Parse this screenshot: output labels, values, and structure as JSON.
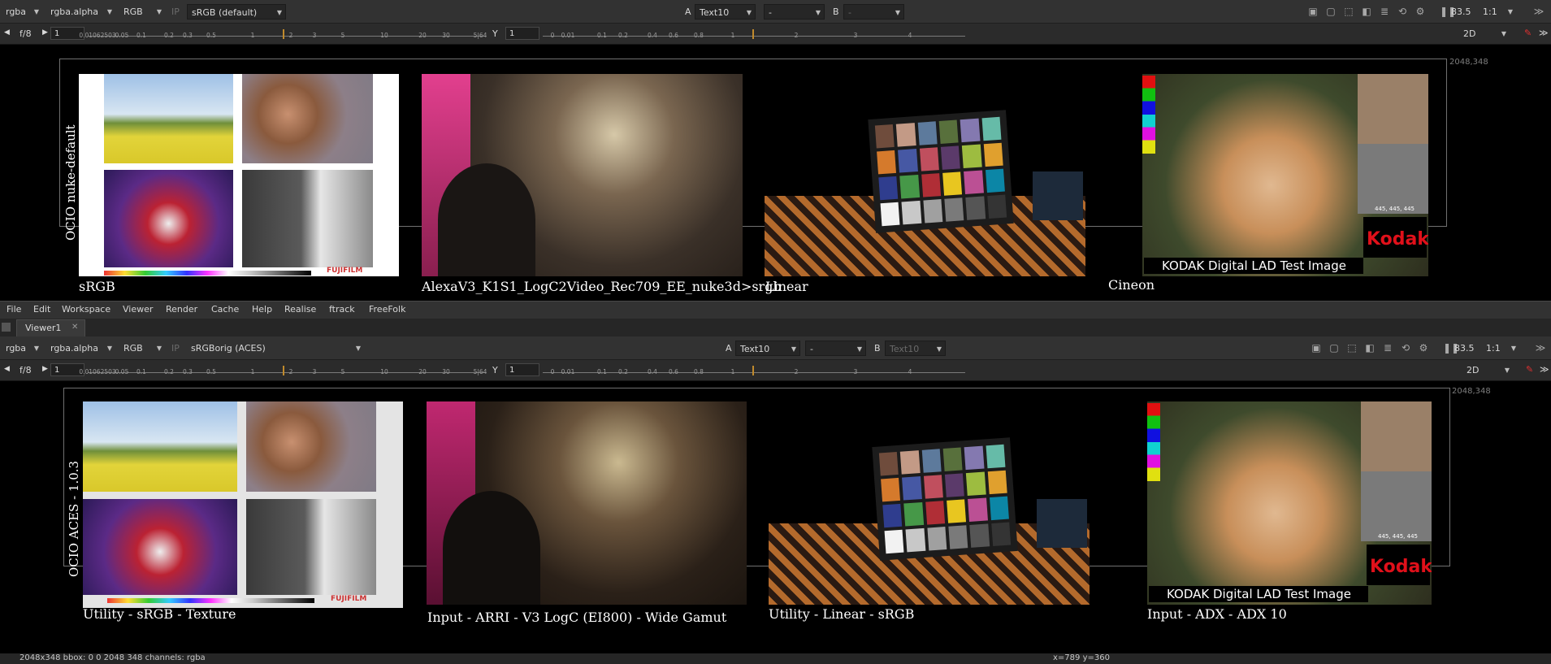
{
  "viewers": [
    {
      "toolbar": {
        "channels": "rgba",
        "alpha": "rgba.alpha",
        "display": "RGB",
        "ip_label": "IP",
        "colorspace": "sRGB (default)",
        "a_label": "A",
        "a_input": "Text10",
        "compare": "-",
        "b_label": "B",
        "b_input": "-",
        "zoom_pct": "83.5",
        "ratio": "1:1"
      },
      "controls": {
        "fstop": "f/8",
        "gain": "1",
        "y_label": "Y",
        "gamma": "1",
        "mode": "2D",
        "gain_ticks": [
          "0.01062503",
          "0.05",
          "0.1",
          "0.2",
          "0.3",
          "0.5",
          "1",
          "2",
          "3",
          "5",
          "10",
          "20",
          "30",
          "5|64"
        ],
        "gamma_ticks": [
          "0",
          "0.01",
          "0.1",
          "0.2",
          "0.4",
          "0.6",
          "0.8",
          "1",
          "2",
          "3",
          "4"
        ]
      },
      "format_coord": "2048,348",
      "side_label": "OCIO nuke-default",
      "captions": [
        "sRGB",
        "AlexaV3_K1S1_LogC2Video_Rec709_EE_nuke3d>srgb",
        "Linear",
        "Cineon"
      ],
      "kodak_caption": "KODAK Digital LAD Test Image",
      "kodak_logo": "Kodak",
      "fujifilm": "FUJIFILM",
      "patch_values": "445, 445, 445"
    },
    {
      "toolbar": {
        "channels": "rgba",
        "alpha": "rgba.alpha",
        "display": "RGB",
        "ip_label": "IP",
        "colorspace": "sRGBorig (ACES)",
        "a_label": "A",
        "a_input": "Text10",
        "compare": "-",
        "b_label": "B",
        "b_input": "Text10",
        "zoom_pct": "83.5",
        "ratio": "1:1"
      },
      "controls": {
        "fstop": "f/8",
        "gain": "1",
        "y_label": "Y",
        "gamma": "1",
        "mode": "2D",
        "gain_ticks": [
          "0.01062503",
          "0.05",
          "0.1",
          "0.2",
          "0.3",
          "0.5",
          "1",
          "2",
          "3",
          "5",
          "10",
          "20",
          "30",
          "5|64"
        ],
        "gamma_ticks": [
          "0",
          "0.01",
          "0.1",
          "0.2",
          "0.4",
          "0.6",
          "0.8",
          "1",
          "2",
          "3",
          "4"
        ]
      },
      "format_coord": "2048,348",
      "side_label": "OCIO ACES - 1.0.3",
      "captions": [
        "Utility - sRGB - Texture",
        "Input - ARRI - V3 LogC (EI800) - Wide Gamut",
        "Utility - Linear - sRGB",
        "Input - ADX - ADX 10"
      ],
      "kodak_caption": "KODAK Digital LAD Test Image",
      "kodak_logo": "Kodak",
      "fujifilm": "FUJIFILM",
      "patch_values": "445, 445, 445"
    }
  ],
  "menu": [
    "File",
    "Edit",
    "Workspace",
    "Viewer",
    "Render",
    "Cache",
    "Help",
    "Realise",
    "ftrack",
    "FreeFolk"
  ],
  "viewer_tab": "Viewer1",
  "status": {
    "info": "2048x348  bbox: 0 0 2048 348  channels: rgba",
    "cursor": "x=789 y=360"
  },
  "colors": {
    "chrome": "#323232",
    "viewport": "#000000",
    "accent_handle": "#c08a2c",
    "kodak_red": "#e0101a"
  },
  "icons": [
    "rgb-swatch-icon",
    "frame-icon",
    "roi-icon",
    "wipe-icon",
    "lut-icon",
    "refresh-icon",
    "settings-icon",
    "pause-icon",
    "paint-icon",
    "menu-chevron-icon"
  ]
}
